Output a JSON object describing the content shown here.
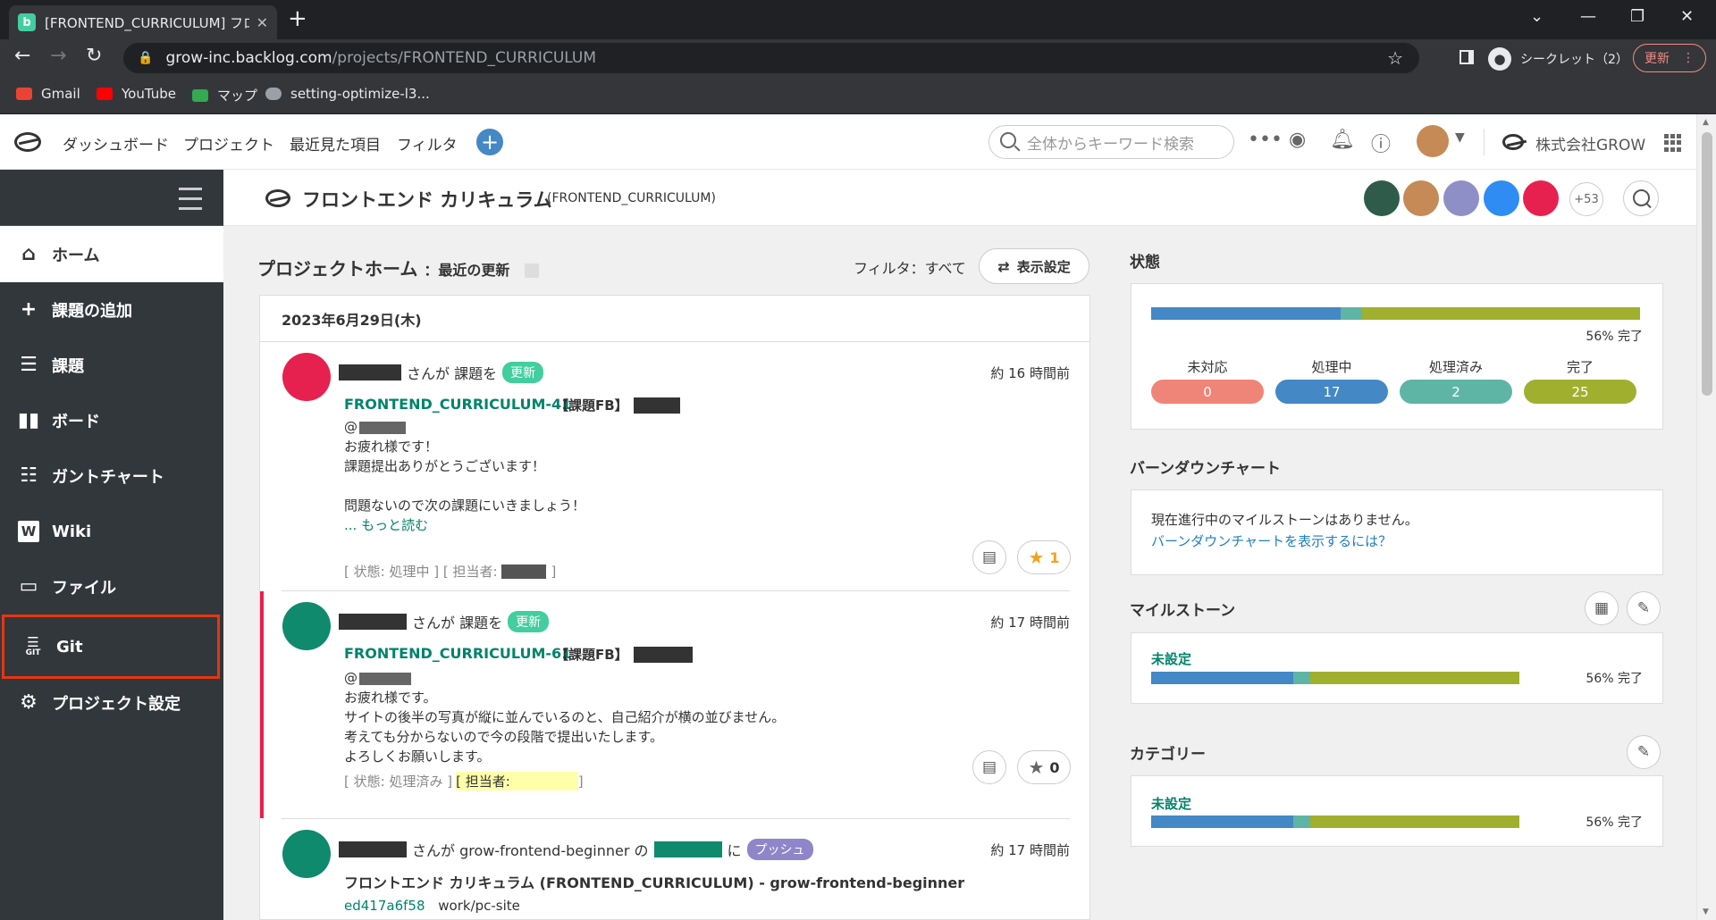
{
  "browser": {
    "tab_title": "[FRONTEND_CURRICULUM] フロン",
    "tab_favicon": "b",
    "url_host": "grow-inc.backlog.com",
    "url_path": "/projects/FRONTEND_CURRICULUM",
    "incognito_label": "シークレット（2）",
    "update_label": "更新",
    "bookmarks": [
      "Gmail",
      "YouTube",
      "マップ",
      "setting-optimize-l3..."
    ]
  },
  "header": {
    "nav": [
      "ダッシュボード",
      "プロジェクト",
      "最近見た項目",
      "フィルタ"
    ],
    "search_placeholder": "全体からキーワード検索",
    "org_name": "株式会社GROW"
  },
  "sidebar": {
    "items": [
      "ホーム",
      "課題の追加",
      "課題",
      "ボード",
      "ガントチャート",
      "Wiki",
      "ファイル",
      "Git",
      "プロジェクト設定"
    ],
    "git_sub": "GIT"
  },
  "project": {
    "name": "フロントエンド カリキュラム",
    "key": "(FRONTEND_CURRICULUM)",
    "member_more": "+53"
  },
  "feed": {
    "heading": "プロジェクトホーム",
    "subheading": "最近の更新",
    "filter_label": "フィルタ：すべて",
    "display_settings": "表示設定",
    "date": "2023年6月29日(木)",
    "entries": [
      {
        "actor_suffix": "さんが 課題を",
        "badge": "更新",
        "time": "約 16 時間前",
        "issue_key": "FRONTEND_CURRICULUM-41",
        "issue_title": "【課題FB】",
        "mention": "@",
        "body": [
          "お疲れ様です！",
          "課題提出ありがとうございます！",
          "",
          "問題ないので次の課題にいきましょう！"
        ],
        "more": "... もっと読む",
        "meta_status": "[ 状態: 処理中 ] [ 担当者:",
        "meta_end": "]",
        "stars": "1"
      },
      {
        "actor_suffix": "さんが 課題を",
        "badge": "更新",
        "time": "約 17 時間前",
        "issue_key": "FRONTEND_CURRICULUM-61",
        "issue_title": "【課題FB】",
        "mention": "@",
        "body": [
          "お疲れ様です。",
          "サイトの後半の写真が縦に並んでいるのと、自己紹介が横の並びません。",
          "考えても分からないので今の段階で提出いたします。",
          "よろしくお願いします。"
        ],
        "meta_status": "[ 状態: 処理済み ]",
        "meta_assignee": "[ 担当者:",
        "meta_end": "]",
        "stars": "0"
      },
      {
        "actor_suffix": "さんが grow-frontend-beginner の",
        "actor_mid": "に",
        "badge": "プッシュ",
        "time": "約 17 時間前",
        "repo_line": "フロントエンド カリキュラム (FRONTEND_CURRICULUM) - grow-frontend-beginner",
        "commit_hash": "ed417a6f58",
        "commit_msg": "work/pc-site"
      }
    ]
  },
  "status_panel": {
    "title": "状態",
    "percent_label": "56% 完了",
    "progress": {
      "not_started": 0.0,
      "in_progress": 0.386,
      "resolved": 0.045,
      "closed": 0.568
    },
    "columns": [
      {
        "label": "未対応",
        "count": "0",
        "color": "#ee8578"
      },
      {
        "label": "処理中",
        "count": "17",
        "color": "#4488c5"
      },
      {
        "label": "処理済み",
        "count": "2",
        "color": "#5eb5a6"
      },
      {
        "label": "完了",
        "count": "25",
        "color": "#a1af2f"
      }
    ]
  },
  "burndown": {
    "title": "バーンダウンチャート",
    "message": "現在進行中のマイルストーンはありません。",
    "link": "バーンダウンチャートを表示するには？"
  },
  "milestone": {
    "title": "マイルストーン",
    "name": "未設定",
    "percent_label": "56% 完了",
    "progress": {
      "in_progress": 0.386,
      "resolved": 0.045,
      "closed": 0.568
    }
  },
  "category": {
    "title": "カテゴリー",
    "name": "未設定",
    "percent_label": "56% 完了",
    "progress": {
      "in_progress": 0.386,
      "resolved": 0.045,
      "closed": 0.568
    }
  },
  "colors": {
    "in_progress": "#4488c5",
    "resolved": "#5eb5a6",
    "closed": "#a1af2f",
    "link_green": "#00836b",
    "badge_update": "#42ce9f",
    "badge_push": "#8e86c8",
    "sidebar_bg": "#32373c",
    "highlight_border": "#e8350f"
  }
}
